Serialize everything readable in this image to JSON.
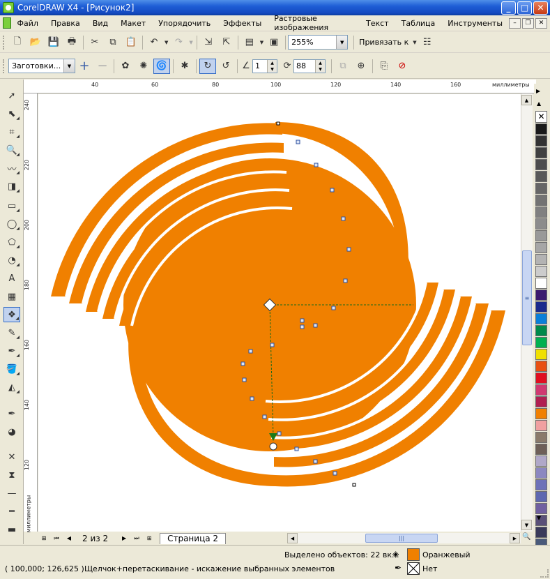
{
  "window": {
    "title": "CorelDRAW X4 - [Рисунок2]"
  },
  "menu": [
    "Файл",
    "Правка",
    "Вид",
    "Макет",
    "Упорядочить",
    "Эффекты",
    "Растровые изображения",
    "Текст",
    "Таблица",
    "Инструменты"
  ],
  "toolbar": {
    "zoom": "255%",
    "snap_label": "Привязать к"
  },
  "property_bar": {
    "presets": "Заготовки...",
    "amplitude": "1",
    "frequency": "88"
  },
  "rulers": {
    "units": "миллиметры",
    "h_labels": [
      "40",
      "60",
      "80",
      "100",
      "120",
      "140",
      "160"
    ],
    "v_labels": [
      "240",
      "220",
      "200",
      "180",
      "160",
      "140",
      "120"
    ]
  },
  "doc_nav": {
    "page_count": "2 из 2",
    "page_tab": "Страница 2"
  },
  "status": {
    "selection": "Выделено объектов: 22 вк...",
    "fill_name": "Оранжевый",
    "outline_name": "Нет",
    "coords": "( 100,000; 126,625 )",
    "hint": "Щелчок+перетаскивание - искажение выбранных элементов"
  },
  "colors": {
    "fill": "#f08000",
    "palette": [
      "#ffffff00",
      "#1a1a1a",
      "#333333",
      "#404040",
      "#4d4d4d",
      "#595959",
      "#666666",
      "#737373",
      "#808080",
      "#8c8c8c",
      "#999999",
      "#a6a6a6",
      "#b3b3b3",
      "#cccccc",
      "#ffffff",
      "#3c1a6e",
      "#1a2a8c",
      "#0a7fd8",
      "#008a4a",
      "#00b050",
      "#f0e000",
      "#e85010",
      "#e01020",
      "#d03a70",
      "#b02050",
      "#f08000",
      "#f0a0a0",
      "#8a7a6a",
      "#6e6058",
      "#b0a8c8",
      "#8c88c0",
      "#6e72b8",
      "#5e68b0",
      "#7060a0",
      "#5a5078",
      "#3a3a5a",
      "#4a5a7a",
      "#2a5a9a",
      "#6ab0e8",
      "#8a9aa8",
      "#a8b0b8"
    ]
  }
}
